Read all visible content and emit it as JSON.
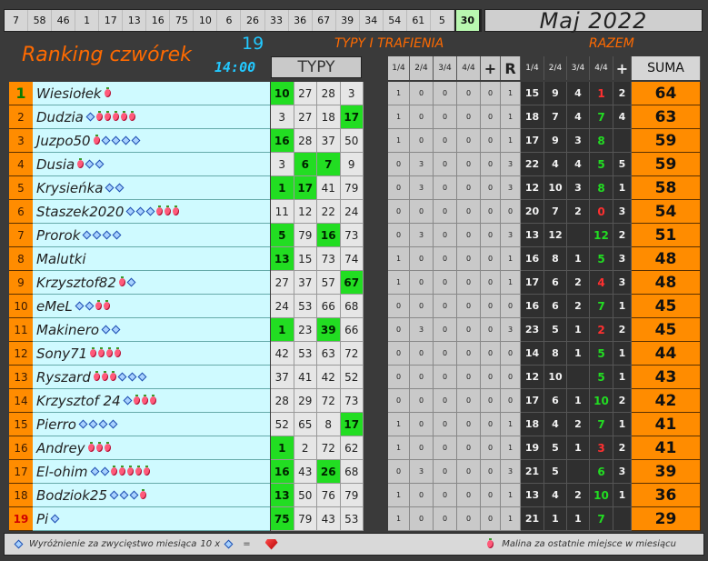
{
  "top_numbers": [
    "7",
    "58",
    "46",
    "1",
    "17",
    "13",
    "16",
    "75",
    "10",
    "6",
    "26",
    "33",
    "36",
    "67",
    "39",
    "34",
    "54",
    "61",
    "5",
    "30"
  ],
  "top_highlight_index": 19,
  "month": "Maj 2022",
  "title": "Ranking czwórek",
  "round": "19",
  "time": "14:00",
  "typy_trafienia": "TYPY I TRAFIENIA",
  "razem": "RAZEM",
  "typy_header": "TYPY",
  "stats_headers": [
    "1/4",
    "2/4",
    "3/4",
    "4/4",
    "+",
    "R",
    "1/4",
    "2/4",
    "3/4",
    "4/4",
    "+",
    "SUMA"
  ],
  "players": [
    {
      "rank": "1",
      "name": "Wiesiołek",
      "sym": "b",
      "typy": [
        "10",
        "27",
        "28",
        "3"
      ],
      "hits": [
        0
      ],
      "t": [
        "1",
        "0",
        "0",
        "0",
        "0",
        "1"
      ],
      "z": [
        "15",
        "9",
        "4",
        "1",
        "2"
      ],
      "q4c": "r",
      "suma": "64"
    },
    {
      "rank": "2",
      "name": "Dudzia",
      "sym": "dbbbbb",
      "typy": [
        "3",
        "27",
        "18",
        "17"
      ],
      "hits": [
        3
      ],
      "t": [
        "1",
        "0",
        "0",
        "0",
        "0",
        "1"
      ],
      "z": [
        "18",
        "7",
        "4",
        "7",
        "4"
      ],
      "q4c": "g",
      "suma": "63"
    },
    {
      "rank": "3",
      "name": "Juzpo50",
      "sym": "bdddd",
      "typy": [
        "16",
        "28",
        "37",
        "50"
      ],
      "hits": [
        0
      ],
      "t": [
        "1",
        "0",
        "0",
        "0",
        "0",
        "1"
      ],
      "z": [
        "17",
        "9",
        "3",
        "8",
        ""
      ],
      "q4c": "g",
      "suma": "59"
    },
    {
      "rank": "4",
      "name": "Dusia",
      "sym": "bdd",
      "typy": [
        "3",
        "6",
        "7",
        "9"
      ],
      "hits": [
        1,
        2
      ],
      "t": [
        "0",
        "3",
        "0",
        "0",
        "0",
        "3"
      ],
      "z": [
        "22",
        "4",
        "4",
        "5",
        "5"
      ],
      "q4c": "g",
      "suma": "59"
    },
    {
      "rank": "5",
      "name": "Krysieńka",
      "sym": "dd",
      "typy": [
        "1",
        "17",
        "41",
        "79"
      ],
      "hits": [
        0,
        1
      ],
      "t": [
        "0",
        "3",
        "0",
        "0",
        "0",
        "3"
      ],
      "z": [
        "12",
        "10",
        "3",
        "8",
        "1"
      ],
      "q4c": "g",
      "suma": "58"
    },
    {
      "rank": "6",
      "name": "Staszek2020",
      "sym": "dddbbb",
      "typy": [
        "11",
        "12",
        "22",
        "24"
      ],
      "hits": [],
      "t": [
        "0",
        "0",
        "0",
        "0",
        "0",
        "0"
      ],
      "z": [
        "20",
        "7",
        "2",
        "0",
        "3"
      ],
      "q4c": "r",
      "suma": "54"
    },
    {
      "rank": "7",
      "name": "Prorok",
      "sym": "dddd",
      "typy": [
        "5",
        "79",
        "16",
        "73"
      ],
      "hits": [
        0,
        2
      ],
      "t": [
        "0",
        "3",
        "0",
        "0",
        "0",
        "3"
      ],
      "z": [
        "13",
        "12",
        "",
        "12",
        "2"
      ],
      "q4c": "g",
      "suma": "51"
    },
    {
      "rank": "8",
      "name": "Malutki",
      "sym": "",
      "typy": [
        "13",
        "15",
        "73",
        "74"
      ],
      "hits": [
        0
      ],
      "t": [
        "1",
        "0",
        "0",
        "0",
        "0",
        "1"
      ],
      "z": [
        "16",
        "8",
        "1",
        "5",
        "3"
      ],
      "q4c": "g",
      "suma": "48"
    },
    {
      "rank": "9",
      "name": "Krzysztof82",
      "sym": "bd",
      "typy": [
        "27",
        "37",
        "57",
        "67"
      ],
      "hits": [
        3
      ],
      "t": [
        "1",
        "0",
        "0",
        "0",
        "0",
        "1"
      ],
      "z": [
        "17",
        "6",
        "2",
        "4",
        "3"
      ],
      "q4c": "r",
      "suma": "48"
    },
    {
      "rank": "10",
      "name": "eMeL",
      "sym": "ddbb",
      "typy": [
        "24",
        "53",
        "66",
        "68"
      ],
      "hits": [],
      "t": [
        "0",
        "0",
        "0",
        "0",
        "0",
        "0"
      ],
      "z": [
        "16",
        "6",
        "2",
        "7",
        "1"
      ],
      "q4c": "g",
      "suma": "45"
    },
    {
      "rank": "11",
      "name": "Makinero",
      "sym": "dd",
      "typy": [
        "1",
        "23",
        "39",
        "66"
      ],
      "hits": [
        0,
        2
      ],
      "t": [
        "0",
        "3",
        "0",
        "0",
        "0",
        "3"
      ],
      "z": [
        "23",
        "5",
        "1",
        "2",
        "2"
      ],
      "q4c": "r",
      "suma": "45"
    },
    {
      "rank": "12",
      "name": "Sony71",
      "sym": "bbbb",
      "typy": [
        "42",
        "53",
        "63",
        "72"
      ],
      "hits": [],
      "t": [
        "0",
        "0",
        "0",
        "0",
        "0",
        "0"
      ],
      "z": [
        "14",
        "8",
        "1",
        "5",
        "1"
      ],
      "q4c": "g",
      "suma": "44"
    },
    {
      "rank": "13",
      "name": "Ryszard",
      "sym": "bbbddd",
      "typy": [
        "37",
        "41",
        "42",
        "52"
      ],
      "hits": [],
      "t": [
        "0",
        "0",
        "0",
        "0",
        "0",
        "0"
      ],
      "z": [
        "12",
        "10",
        "",
        "5",
        "1"
      ],
      "q4c": "g",
      "suma": "43"
    },
    {
      "rank": "14",
      "name": "Krzysztof 24",
      "sym": "dbbb",
      "typy": [
        "28",
        "29",
        "72",
        "73"
      ],
      "hits": [],
      "t": [
        "0",
        "0",
        "0",
        "0",
        "0",
        "0"
      ],
      "z": [
        "17",
        "6",
        "1",
        "10",
        "2"
      ],
      "q4c": "g",
      "suma": "42"
    },
    {
      "rank": "15",
      "name": "Pierro",
      "sym": "dddd",
      "typy": [
        "52",
        "65",
        "8",
        "17"
      ],
      "hits": [
        3
      ],
      "t": [
        "1",
        "0",
        "0",
        "0",
        "0",
        "1"
      ],
      "z": [
        "18",
        "4",
        "2",
        "7",
        "1"
      ],
      "q4c": "g",
      "suma": "41"
    },
    {
      "rank": "16",
      "name": "Andrey",
      "sym": "bbb",
      "typy": [
        "1",
        "2",
        "72",
        "62"
      ],
      "hits": [
        0
      ],
      "t": [
        "1",
        "0",
        "0",
        "0",
        "0",
        "1"
      ],
      "z": [
        "19",
        "5",
        "1",
        "3",
        "2"
      ],
      "q4c": "r",
      "suma": "41"
    },
    {
      "rank": "17",
      "name": "El-ohim",
      "sym": "ddbbbbb",
      "typy": [
        "16",
        "43",
        "26",
        "68"
      ],
      "hits": [
        0,
        2
      ],
      "t": [
        "0",
        "3",
        "0",
        "0",
        "0",
        "3"
      ],
      "z": [
        "21",
        "5",
        "",
        "6",
        "3"
      ],
      "q4c": "g",
      "suma": "39"
    },
    {
      "rank": "18",
      "name": "Bodziok25",
      "sym": "dddb",
      "typy": [
        "13",
        "50",
        "76",
        "79"
      ],
      "hits": [
        0
      ],
      "t": [
        "1",
        "0",
        "0",
        "0",
        "0",
        "1"
      ],
      "z": [
        "13",
        "4",
        "2",
        "10",
        "1"
      ],
      "q4c": "g",
      "suma": "36"
    },
    {
      "rank": "19",
      "name": "Pi",
      "sym": "d",
      "typy": [
        "75",
        "79",
        "43",
        "53"
      ],
      "hits": [
        0
      ],
      "t": [
        "1",
        "0",
        "0",
        "0",
        "0",
        "1"
      ],
      "z": [
        "21",
        "1",
        "1",
        "7",
        ""
      ],
      "q4c": "g",
      "suma": "29"
    }
  ],
  "footer": {
    "left": "Wyróżnienie za zwycięstwo miesiąca",
    "left_mult": "10 x",
    "left_eq": "=",
    "right": "Malina za ostatnie miejsce w miesiącu"
  },
  "colors": {
    "orange": "#ff8c00",
    "hit_green": "#22dd22",
    "cyan": "#22c8ff",
    "light_cyan": "#cffaff",
    "red": "#ff3030"
  }
}
